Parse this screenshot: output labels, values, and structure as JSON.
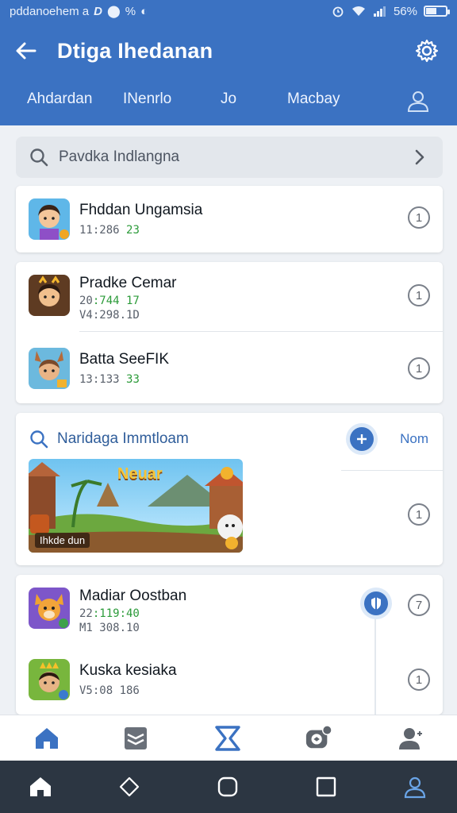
{
  "status": {
    "left_text": "pddanoehem a",
    "indicator_text": "D",
    "battery_text": "56%",
    "battery_level": 0.56
  },
  "header": {
    "title": "Dtiga Ihedanan",
    "tabs": [
      {
        "label": "Ahdardan"
      },
      {
        "label": "INenrlo"
      },
      {
        "label": "Jo"
      },
      {
        "label": "Macbay"
      }
    ]
  },
  "search": {
    "placeholder": "Pavdka Indlangna"
  },
  "list1": [
    {
      "name": "Fhddan Ungamsia",
      "meta_prefix": "11:286",
      "meta_green": "23",
      "info": "1"
    }
  ],
  "list2": [
    {
      "name": "Pradke Cemar",
      "meta_prefix": "20",
      "meta_green": ":744 17",
      "meta_line2": "V4:298.1D",
      "info": "1"
    },
    {
      "name": "Batta SeeFIK",
      "meta_prefix": "13:133",
      "meta_green": "33",
      "info": "1"
    }
  ],
  "featured": {
    "heading": "Naridaga Immtloam",
    "more_label": "Nom",
    "banner_title": "Neuar",
    "banner_label": "Ihkde dun",
    "info": "1"
  },
  "list3": [
    {
      "name": "Madiar Oostban",
      "meta_prefix": "22",
      "meta_green": ":119:40",
      "meta_line2": "M1 308.10",
      "info": "7"
    },
    {
      "name": "Kuska kesiaka",
      "meta_prefix": "V5:08 186",
      "meta_green": "",
      "info": "1"
    }
  ],
  "icons": {
    "back": "back-arrow-icon",
    "settings": "gear-icon",
    "search": "search-icon",
    "chevron": "chevron-right-icon"
  },
  "colors": {
    "primary": "#3b72c2",
    "header": "#3b72c2",
    "green_text": "#2c9b3a",
    "system_bar": "#2c3642"
  }
}
